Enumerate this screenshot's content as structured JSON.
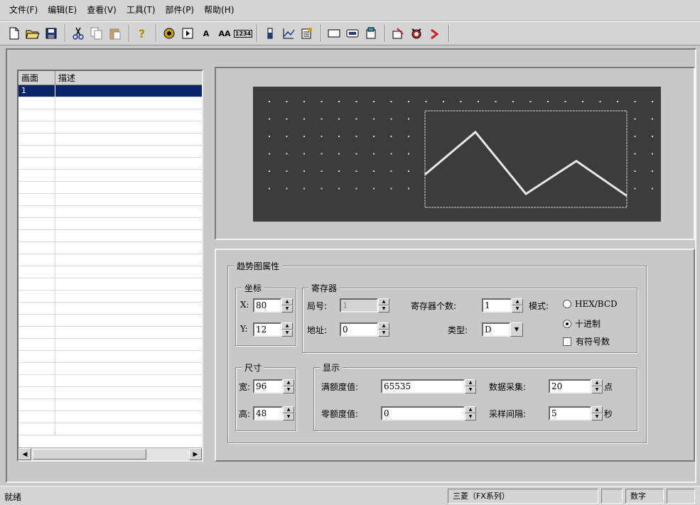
{
  "menu": [
    "文件(F)",
    "编辑(E)",
    "查看(V)",
    "工具(T)",
    "部件(P)",
    "帮助(H)"
  ],
  "toolbar": {
    "text_a": "A",
    "text_aa": "AA",
    "text_num": "1234"
  },
  "screen_list": {
    "headers": [
      "画面",
      "描述"
    ],
    "rows": [
      {
        "no": "1",
        "desc": ""
      }
    ]
  },
  "preview": {
    "trend_points": [
      0.66,
      0.22,
      0.86,
      0.52,
      0.88
    ]
  },
  "props": {
    "title": "趋势图属性",
    "coord": {
      "title": "坐标",
      "x_label": "X:",
      "x_value": "80",
      "y_label": "Y:",
      "y_value": "12"
    },
    "register": {
      "title": "寄存器",
      "station_label": "局号:",
      "station_value": "1",
      "address_label": "地址:",
      "address_value": "0",
      "count_label": "寄存器个数:",
      "count_value": "1",
      "type_label": "类型:",
      "type_value": "D",
      "mode_label": "模式:",
      "mode_options": [
        "HEX/BCD",
        "十进制"
      ],
      "mode_selected": "十进制",
      "signed_label": "有符号数",
      "signed_checked": false
    },
    "size": {
      "title": "尺寸",
      "width_label": "宽:",
      "width_value": "96",
      "height_label": "高:",
      "height_value": "48"
    },
    "display": {
      "title": "显示",
      "full_scale_label": "满额度值:",
      "full_scale_value": "65535",
      "zero_scale_label": "零额度值:",
      "zero_scale_value": "0",
      "sample_count_label": "数据采集:",
      "sample_count_value": "20",
      "sample_count_unit": "点",
      "interval_label": "采样间隔:",
      "interval_value": "5",
      "interval_unit": "秒"
    }
  },
  "status": {
    "left": "就绪",
    "plc": "三菱（FX系列）",
    "num": "数字"
  },
  "colors": {
    "canvas_bg": "#3c3c3c",
    "selection": "#0a246a",
    "trend_line": "#e8e8e8"
  }
}
